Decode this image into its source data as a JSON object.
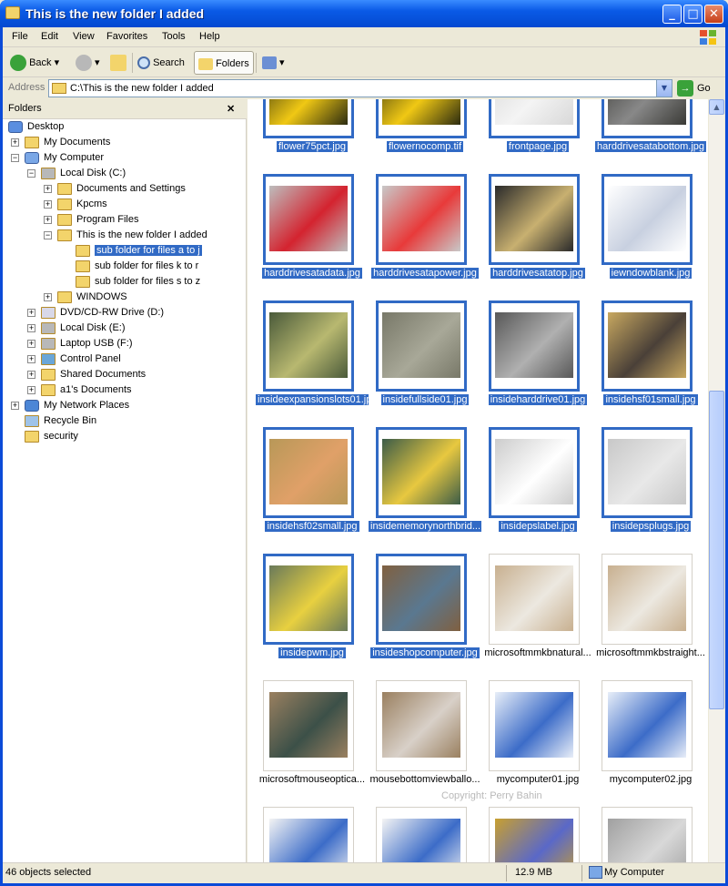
{
  "window": {
    "title": "This is the new folder I added",
    "min": "_",
    "max": "□",
    "close": "✕"
  },
  "menu": [
    "File",
    "Edit",
    "View",
    "Favorites",
    "Tools",
    "Help"
  ],
  "toolbar": {
    "back": "Back",
    "search": "Search",
    "folders": "Folders"
  },
  "address": {
    "label": "Address",
    "value": "C:\\This is the new folder I added",
    "go": "Go"
  },
  "folders_pane": {
    "title": "Folders",
    "close": "✕",
    "tree": [
      {
        "label": "Desktop"
      },
      {
        "label": "My Documents"
      },
      {
        "label": "My Computer"
      },
      {
        "label": "Local Disk (C:)"
      },
      {
        "label": "Documents and Settings"
      },
      {
        "label": "Kpcms"
      },
      {
        "label": "Program Files"
      },
      {
        "label": "This is the new folder I added"
      },
      {
        "label": "sub folder for files a to j"
      },
      {
        "label": "sub folder for files k to r"
      },
      {
        "label": "sub folder for files s to z"
      },
      {
        "label": "WINDOWS"
      },
      {
        "label": "DVD/CD-RW Drive (D:)"
      },
      {
        "label": "Local Disk (E:)"
      },
      {
        "label": "Laptop USB (F:)"
      },
      {
        "label": "Control Panel"
      },
      {
        "label": "Shared Documents"
      },
      {
        "label": "a1's Documents"
      },
      {
        "label": "My Network Places"
      },
      {
        "label": "Recycle Bin"
      },
      {
        "label": "security"
      }
    ]
  },
  "files": [
    {
      "name": "flower75pct.jpg",
      "selected": true
    },
    {
      "name": "flowernocomp.tif",
      "selected": true
    },
    {
      "name": "frontpage.jpg",
      "selected": true
    },
    {
      "name": "harddrivesatabottom.jpg",
      "selected": true
    },
    {
      "name": "harddrivesatadata.jpg",
      "selected": true
    },
    {
      "name": "harddrivesatapower.jpg",
      "selected": true
    },
    {
      "name": "harddrivesatatop.jpg",
      "selected": true
    },
    {
      "name": "iewndowblank.jpg",
      "selected": true
    },
    {
      "name": "insideexpansionslots01.jpg",
      "selected": true
    },
    {
      "name": "insidefullside01.jpg",
      "selected": true
    },
    {
      "name": "insideharddrive01.jpg",
      "selected": true
    },
    {
      "name": "insidehsf01small.jpg",
      "selected": true
    },
    {
      "name": "insidehsf02small.jpg",
      "selected": true
    },
    {
      "name": "insidememorynorthbrid...",
      "selected": true
    },
    {
      "name": "insidepslabel.jpg",
      "selected": true
    },
    {
      "name": "insidepsplugs.jpg",
      "selected": true
    },
    {
      "name": "insidepwm.jpg",
      "selected": true
    },
    {
      "name": "insideshopcomputer.jpg",
      "selected": true
    },
    {
      "name": "microsoftmmkbnatural...",
      "selected": false
    },
    {
      "name": "microsoftmmkbstraight...",
      "selected": false
    },
    {
      "name": "microsoftmouseoptica...",
      "selected": false
    },
    {
      "name": "mousebottomviewballo...",
      "selected": false
    },
    {
      "name": "mycomputer01.jpg",
      "selected": false
    },
    {
      "name": "mycomputer02.jpg",
      "selected": false
    },
    {
      "name": "",
      "selected": false
    },
    {
      "name": "",
      "selected": false
    },
    {
      "name": "",
      "selected": false
    },
    {
      "name": "",
      "selected": false
    }
  ],
  "watermark": "Copyright: Perry Bahin",
  "status": {
    "objects": "46 objects selected",
    "size": "12.9 MB",
    "location": "My Computer"
  }
}
